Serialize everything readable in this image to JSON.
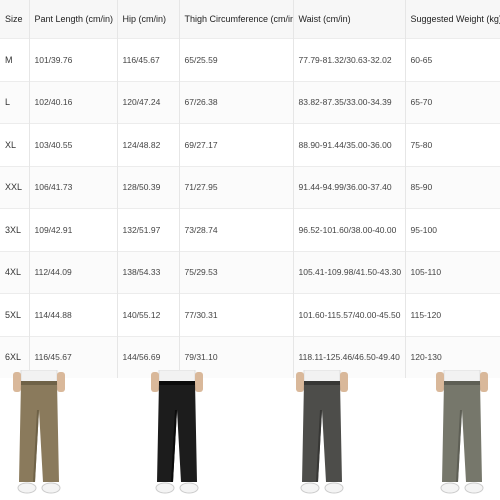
{
  "table": {
    "headers": [
      "Size",
      "Pant Length (cm/in)",
      "Hip (cm/in)",
      "Thigh Circumference (cm/in)",
      "Waist (cm/in)",
      "Suggested Weight (kg)"
    ],
    "rows": [
      [
        "M",
        "101/39.76",
        "116/45.67",
        "65/25.59",
        "77.79-81.32/30.63-32.02",
        "60-65"
      ],
      [
        "L",
        "102/40.16",
        "120/47.24",
        "67/26.38",
        "83.82-87.35/33.00-34.39",
        "65-70"
      ],
      [
        "XL",
        "103/40.55",
        "124/48.82",
        "69/27.17",
        "88.90-91.44/35.00-36.00",
        "75-80"
      ],
      [
        "XXL",
        "106/41.73",
        "128/50.39",
        "71/27.95",
        "91.44-94.99/36.00-37.40",
        "85-90"
      ],
      [
        "3XL",
        "109/42.91",
        "132/51.97",
        "73/28.74",
        "96.52-101.60/38.00-40.00",
        "95-100"
      ],
      [
        "4XL",
        "112/44.09",
        "138/54.33",
        "75/29.53",
        "105.41-109.98/41.50-43.30",
        "105-110"
      ],
      [
        "5XL",
        "114/44.88",
        "140/55.12",
        "77/30.31",
        "101.60-115.57/40.00-45.50",
        "115-120"
      ],
      [
        "6XL",
        "116/45.67",
        "144/56.69",
        "79/31.10",
        "118.11-125.46/46.50-49.40",
        "120-130"
      ]
    ]
  },
  "products": [
    {
      "color": "#8a7a5c",
      "shade": "#6f6247"
    },
    {
      "color": "#1c1c1c",
      "shade": "#0b0b0b"
    },
    {
      "color": "#4d4d4a",
      "shade": "#373735"
    },
    {
      "color": "#76776b",
      "shade": "#5e5f55"
    }
  ]
}
